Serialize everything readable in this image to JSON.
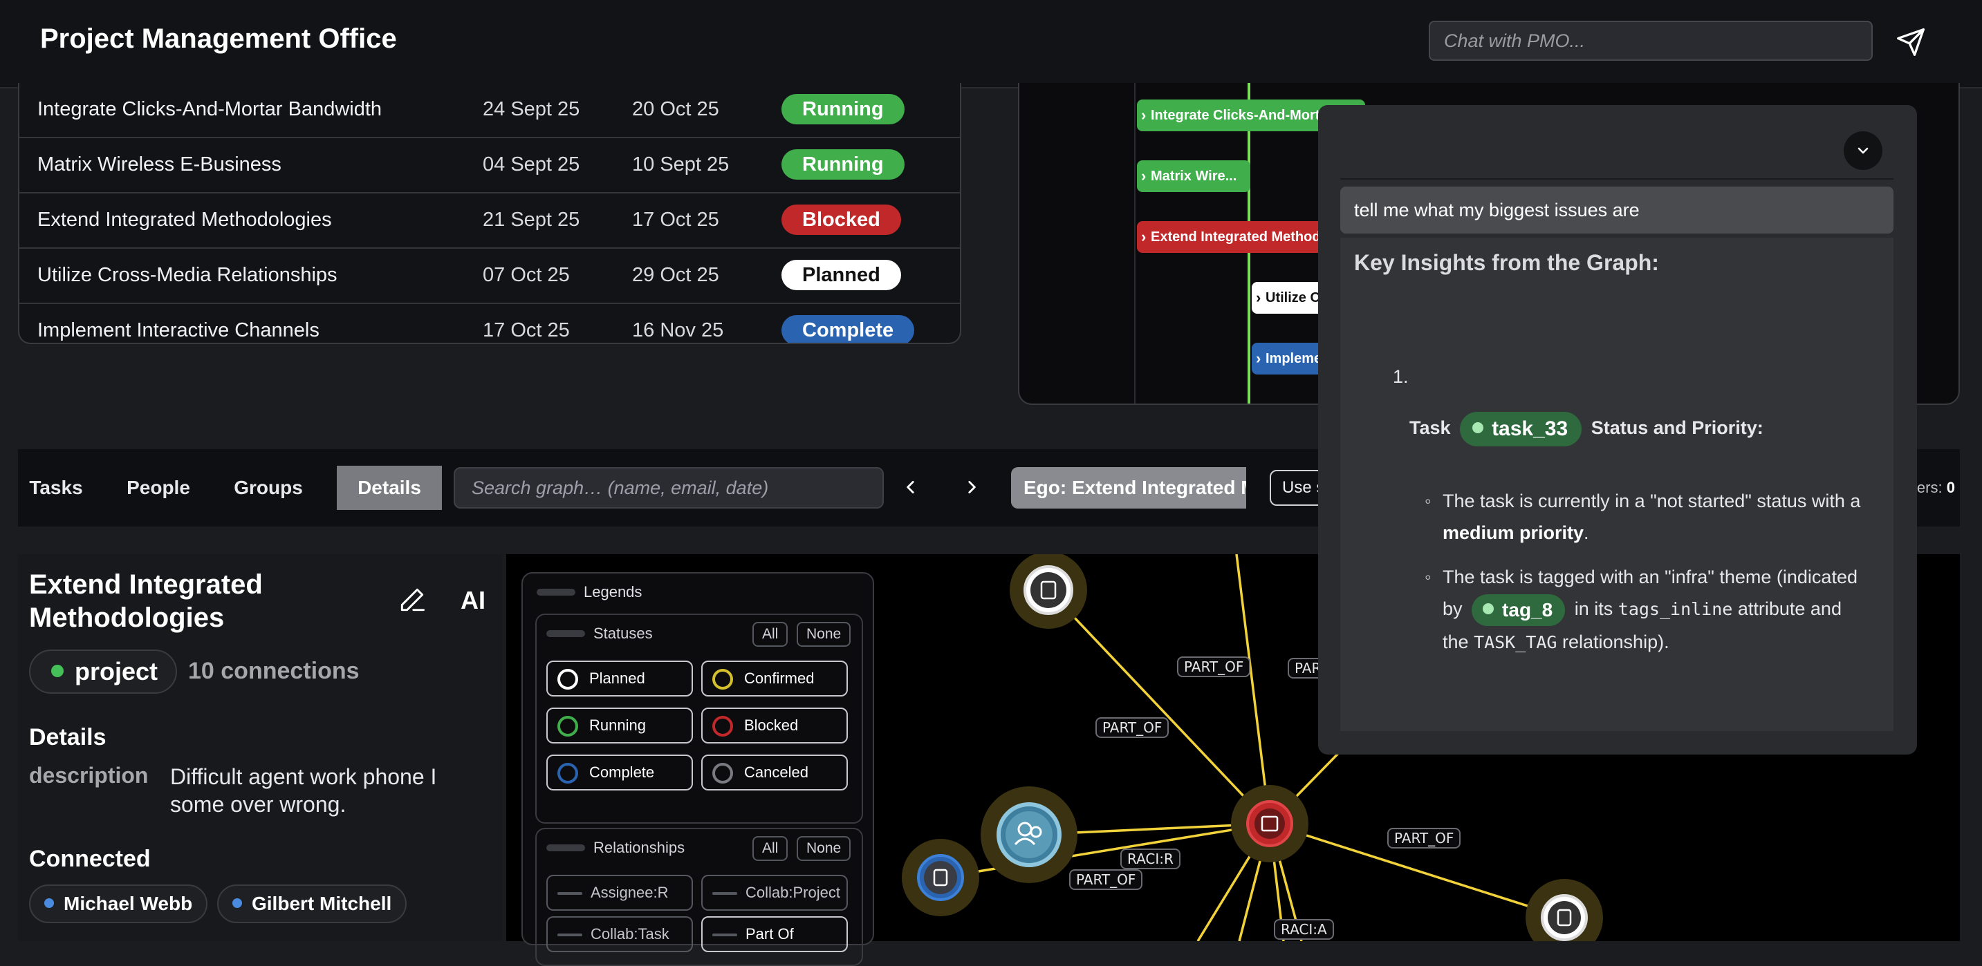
{
  "header": {
    "title": "Project Management Office",
    "chat_placeholder": "Chat with PMO...",
    "send_icon": "send-icon"
  },
  "tasks": [
    {
      "name": "Integrate Clicks-And-Mortar Bandwidth",
      "start": "24 Sept 25",
      "end": "20 Oct 25",
      "status": "Running"
    },
    {
      "name": "Matrix Wireless E-Business",
      "start": "04 Sept 25",
      "end": "10 Sept 25",
      "status": "Running"
    },
    {
      "name": "Extend Integrated Methodologies",
      "start": "21 Sept 25",
      "end": "17 Oct 25",
      "status": "Blocked"
    },
    {
      "name": "Utilize Cross-Media Relationships",
      "start": "07 Oct 25",
      "end": "29 Oct 25",
      "status": "Planned"
    },
    {
      "name": "Implement Interactive Channels",
      "start": "17 Oct 25",
      "end": "16 Nov 25",
      "status": "Complete"
    }
  ],
  "status_colors": {
    "Running": "#3fae4b",
    "Blocked": "#c0282a",
    "Planned": "#ffffff",
    "Complete": "#2a64b0"
  },
  "gantt": {
    "bars": [
      {
        "label": "Integrate Clicks-And-Mortar",
        "status": "Running"
      },
      {
        "label": "Matrix Wire...",
        "status": "Running"
      },
      {
        "label": "Extend Integrated Methodo...",
        "status": "Blocked"
      },
      {
        "label": "Utilize Cros...",
        "status": "Planned"
      },
      {
        "label": "Implement In...",
        "status": "Complete"
      }
    ]
  },
  "toolbar": {
    "tabs": [
      "Tasks",
      "People",
      "Groups",
      "Details"
    ],
    "active_tab": "Details",
    "search_placeholder": "Search graph… (name, email, date)",
    "prev_icon": "chevron-left-icon",
    "next_icon": "chevron-right-icon",
    "ego_label": "Ego: Extend Integrated Methodologies",
    "use_selection_label": "Use selection",
    "filters_label": "ilters:",
    "filters_count": "0"
  },
  "details": {
    "title": "Extend Integrated Methodologies",
    "ai_label": "AI",
    "type": "project",
    "connections": "10 connections",
    "details_heading": "Details",
    "description_key": "description",
    "description_value": "Difficult agent work phone I some over wrong.",
    "connected_heading": "Connected",
    "connected": [
      "Michael Webb",
      "Gilbert Mitchell"
    ]
  },
  "legends": {
    "title": "Legends",
    "statuses_title": "Statuses",
    "all_label": "All",
    "none_label": "None",
    "statuses": [
      {
        "label": "Planned",
        "color": "#ffffff"
      },
      {
        "label": "Confirmed",
        "color": "#d4c02c"
      },
      {
        "label": "Running",
        "color": "#3fae4b"
      },
      {
        "label": "Blocked",
        "color": "#c0282a"
      },
      {
        "label": "Complete",
        "color": "#2a64b0"
      },
      {
        "label": "Canceled",
        "color": "#7a7b80"
      }
    ],
    "relationships_title": "Relationships",
    "relationships": [
      "Assignee:R",
      "Collab:Project",
      "Collab:Task",
      "Part Of"
    ]
  },
  "graph": {
    "edge_labels": [
      "PART_OF",
      "PART_OF",
      "PART_OF",
      "RACI:R",
      "PART_OF",
      "PART_OF",
      "RACI:A"
    ],
    "edge_color": "#f2d23a"
  },
  "chat": {
    "collapse_icon": "chevron-down-icon",
    "user_message": "tell me what my biggest issues are",
    "reply_heading": "Key Insights from the Graph:",
    "list_number": "1.",
    "task_prefix": "Task",
    "task_tag": "task_33",
    "task_suffix": "Status and Priority:",
    "bullet1_a": "The task is currently in a \"not started\" status with a",
    "bullet1_b": "medium priority",
    "bullet1_c": ".",
    "bullet2_a": "The task is tagged with an \"infra\" theme (indicated by",
    "bullet2_tag": "tag_8",
    "bullet2_b": "in its",
    "bullet2_code1": "tags_inline",
    "bullet2_c": "attribute and the",
    "bullet2_code2": "TASK_TAG",
    "bullet2_d": "relationship)."
  }
}
